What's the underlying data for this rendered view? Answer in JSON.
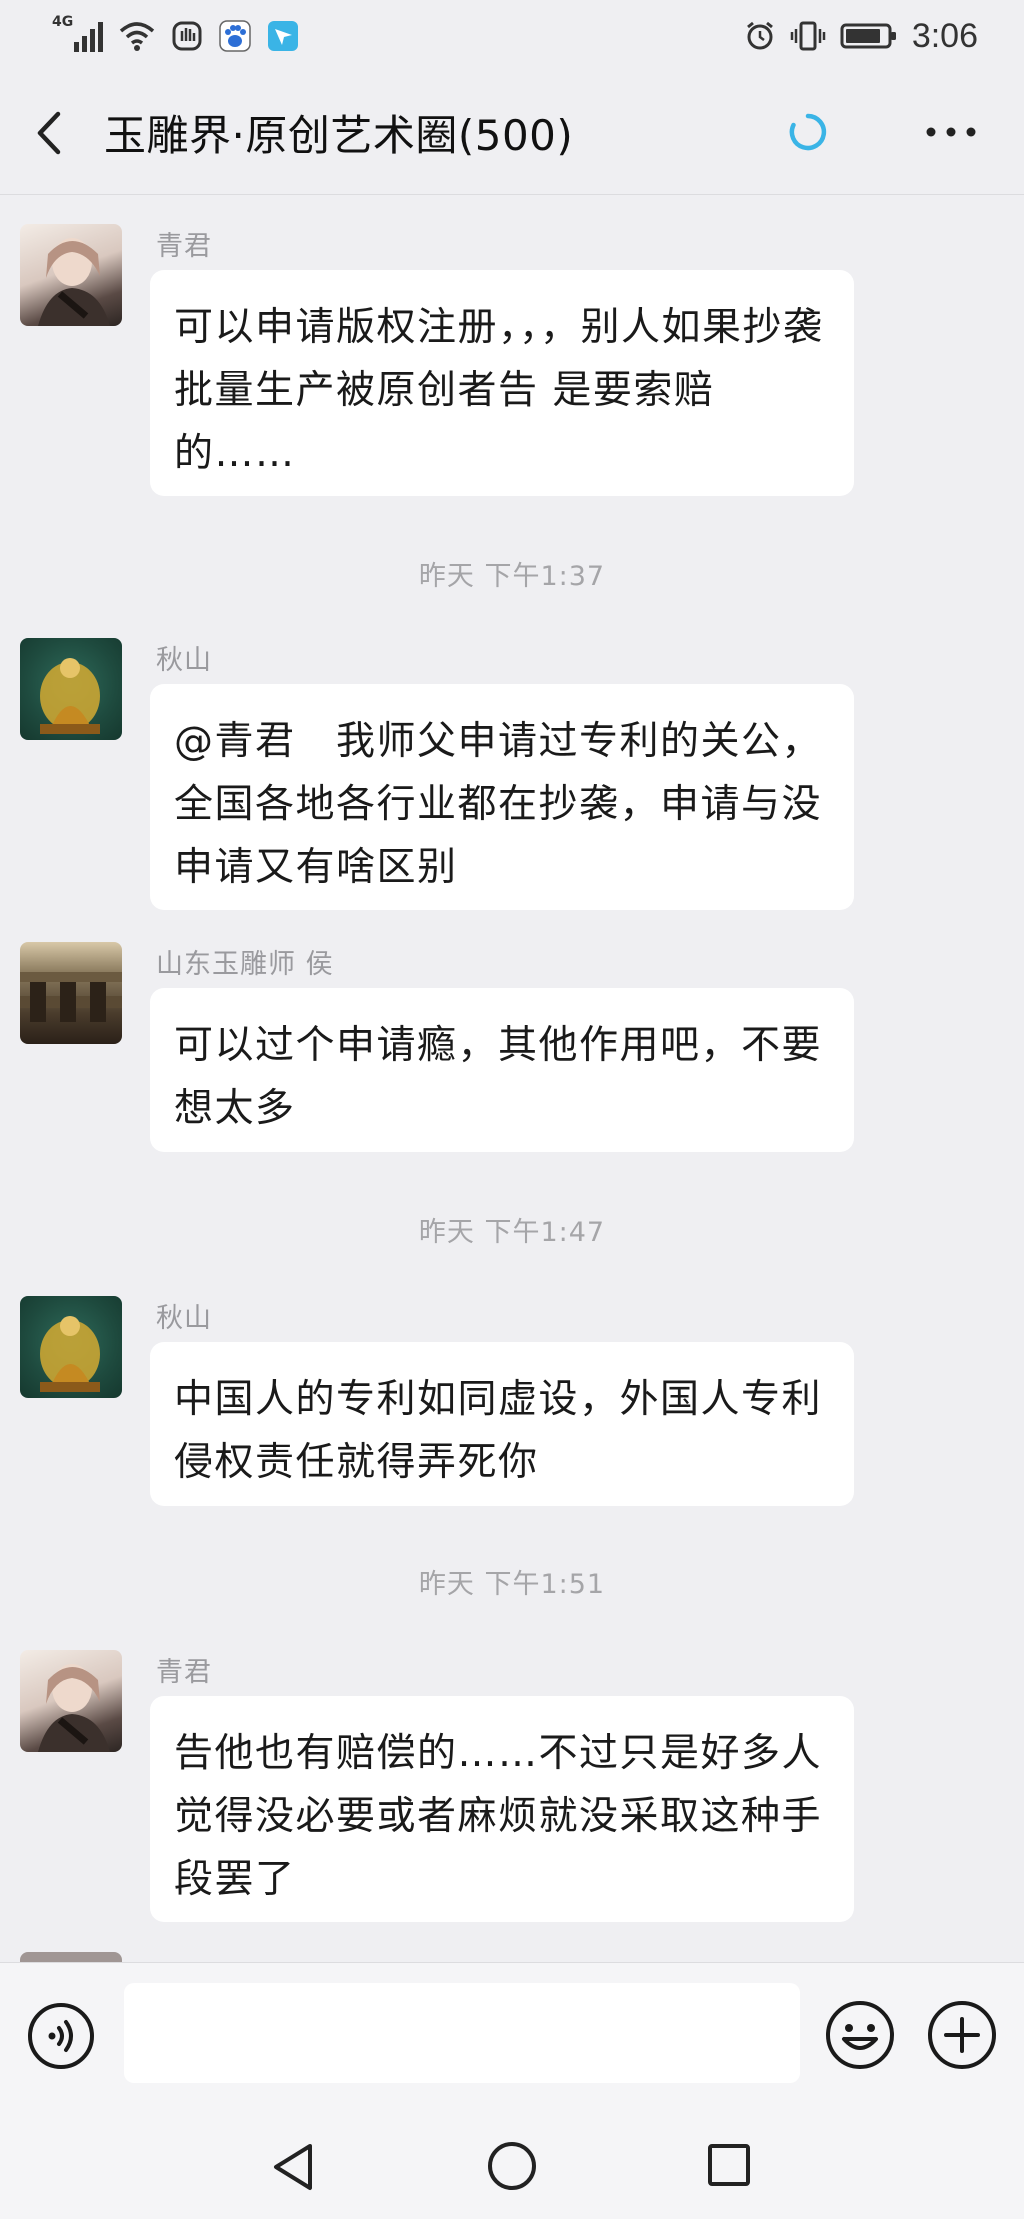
{
  "status_bar": {
    "network": "4G",
    "time": "3:06"
  },
  "header": {
    "back_icon": "chevron-left-icon",
    "title": "玉雕界·原创艺术圈(500)",
    "more_icon": "more-dots-icon"
  },
  "messages": [
    {
      "type": "message",
      "sender": "青君",
      "avatar": "avatar-qingjun",
      "text": "可以申请版权注册，，，别人如果抄袭批量生产被原创者告 是要索赔的……"
    },
    {
      "type": "timestamp",
      "text": "昨天 下午1:37"
    },
    {
      "type": "message",
      "sender": "秋山",
      "avatar": "avatar-qiushan",
      "text": "@青君　我师父申请过专利的关公，全国各地各行业都在抄袭，申请与没申请又有啥区别"
    },
    {
      "type": "message",
      "sender": "山东玉雕师  侯",
      "avatar": "avatar-shandong",
      "text": "可以过个申请瘾，其他作用吧，不要想太多"
    },
    {
      "type": "timestamp",
      "text": "昨天 下午1:47"
    },
    {
      "type": "message",
      "sender": "秋山",
      "avatar": "avatar-qiushan",
      "text": "中国人的专利如同虚设，外国人专利侵权责任就得弄死你"
    },
    {
      "type": "timestamp",
      "text": "昨天 下午1:51"
    },
    {
      "type": "message",
      "sender": "青君",
      "avatar": "avatar-qingjun",
      "text": "告他也有赔偿的……不过只是好多人觉得没必要或者麻烦就没采取这种手段罢了"
    }
  ],
  "input_bar": {
    "voice_icon": "voice-icon",
    "input_value": "",
    "emoji_icon": "emoji-icon",
    "plus_icon": "plus-circle-icon"
  },
  "nav_bar": {
    "back": "triangle-back-icon",
    "home": "circle-home-icon",
    "recent": "square-recent-icon"
  },
  "colors": {
    "background": "#efeff2",
    "bubble": "#ffffff",
    "accent": "#3ab4e6",
    "meta_text": "#9a9a9e"
  }
}
